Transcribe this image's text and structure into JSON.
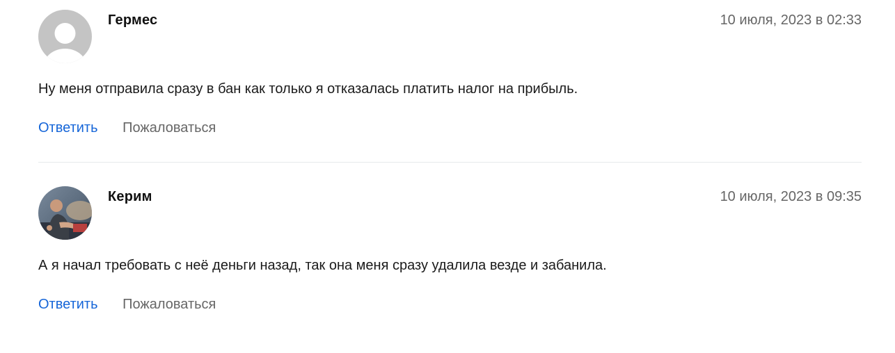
{
  "comments": [
    {
      "author": "Гермес",
      "date": "10 июля, 2023 в 02:33",
      "text": "Ну меня отправила сразу в бан как только я отказалась платить налог на прибыль.",
      "reply_label": "Ответить",
      "report_label": "Пожаловаться",
      "avatar": "default-user-silhouette"
    },
    {
      "author": "Керим",
      "date": "10 июля, 2023 в 09:35",
      "text": "А я начал требовать с неё деньги назад, так она меня сразу удалила везде и забанила.",
      "reply_label": "Ответить",
      "report_label": "Пожаловаться",
      "avatar": "user-photo"
    }
  ],
  "colors": {
    "link": "#1565d8",
    "muted": "#666666",
    "text": "#1a1a1a",
    "divider": "#e6e9ec",
    "avatar_placeholder": "#c4c4c4"
  }
}
